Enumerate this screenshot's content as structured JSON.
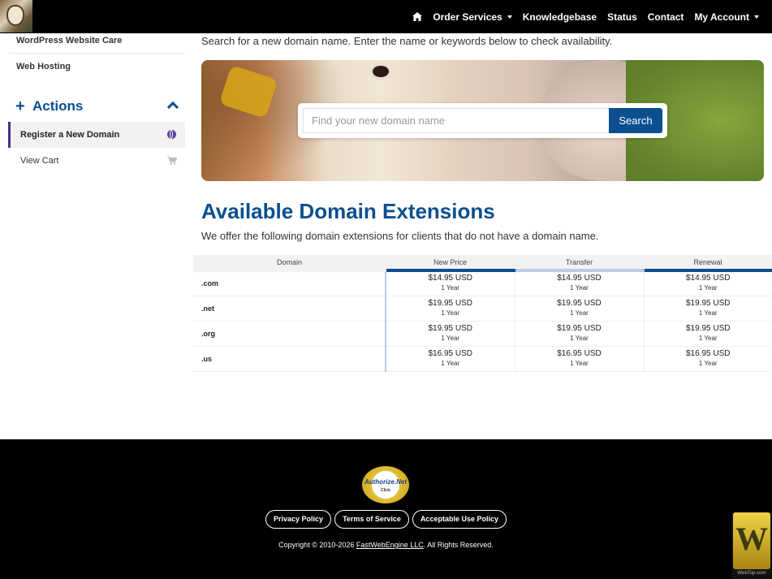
{
  "nav": {
    "items": [
      "Order Services",
      "Knowledgebase",
      "Status",
      "Contact",
      "My Account"
    ]
  },
  "sidebar": {
    "links": [
      "WordPress Website Care",
      "Web Hosting"
    ],
    "actions_title": "Actions",
    "actions": [
      {
        "label": "Register a New Domain",
        "icon": "globe-icon",
        "active": true
      },
      {
        "label": "View Cart",
        "icon": "cart-icon",
        "active": false
      }
    ]
  },
  "main": {
    "intro": "Search for a new domain name. Enter the name or keywords below to check availability.",
    "search": {
      "placeholder": "Find your new domain name",
      "button": "Search"
    },
    "extensions_title": "Available Domain Extensions",
    "extensions_desc": "We offer the following domain extensions for clients that do not have a domain name."
  },
  "table": {
    "headers": [
      "Domain",
      "New Price",
      "Transfer",
      "Renewal"
    ],
    "rows": [
      {
        "tld": ".com",
        "new": "$14.95 USD",
        "transfer": "$14.95 USD",
        "renewal": "$14.95 USD",
        "term": "1 Year"
      },
      {
        "tld": ".net",
        "new": "$19.95 USD",
        "transfer": "$19.95 USD",
        "renewal": "$19.95 USD",
        "term": "1 Year"
      },
      {
        "tld": ".org",
        "new": "$19.95 USD",
        "transfer": "$19.95 USD",
        "renewal": "$19.95 USD",
        "term": "1 Year"
      },
      {
        "tld": ".us",
        "new": "$16.95 USD",
        "transfer": "$16.95 USD",
        "renewal": "$16.95 USD",
        "term": "1 Year"
      }
    ]
  },
  "footer": {
    "seal_text": "Authorize.Net",
    "seal_sub": "Click",
    "links": [
      "Privacy Policy",
      "Terms of Service",
      "Acceptable Use Policy"
    ],
    "copyright_pre": "Copyright © 2010-2026",
    "company": "FastWebEngine LLC",
    "copyright_post": ". All Rights Reserved.",
    "badge_letter": "W",
    "badge_label": "WebTop.com"
  },
  "colors": {
    "brand": "#0b4f8f",
    "active_accent": "#4a2f8a"
  }
}
